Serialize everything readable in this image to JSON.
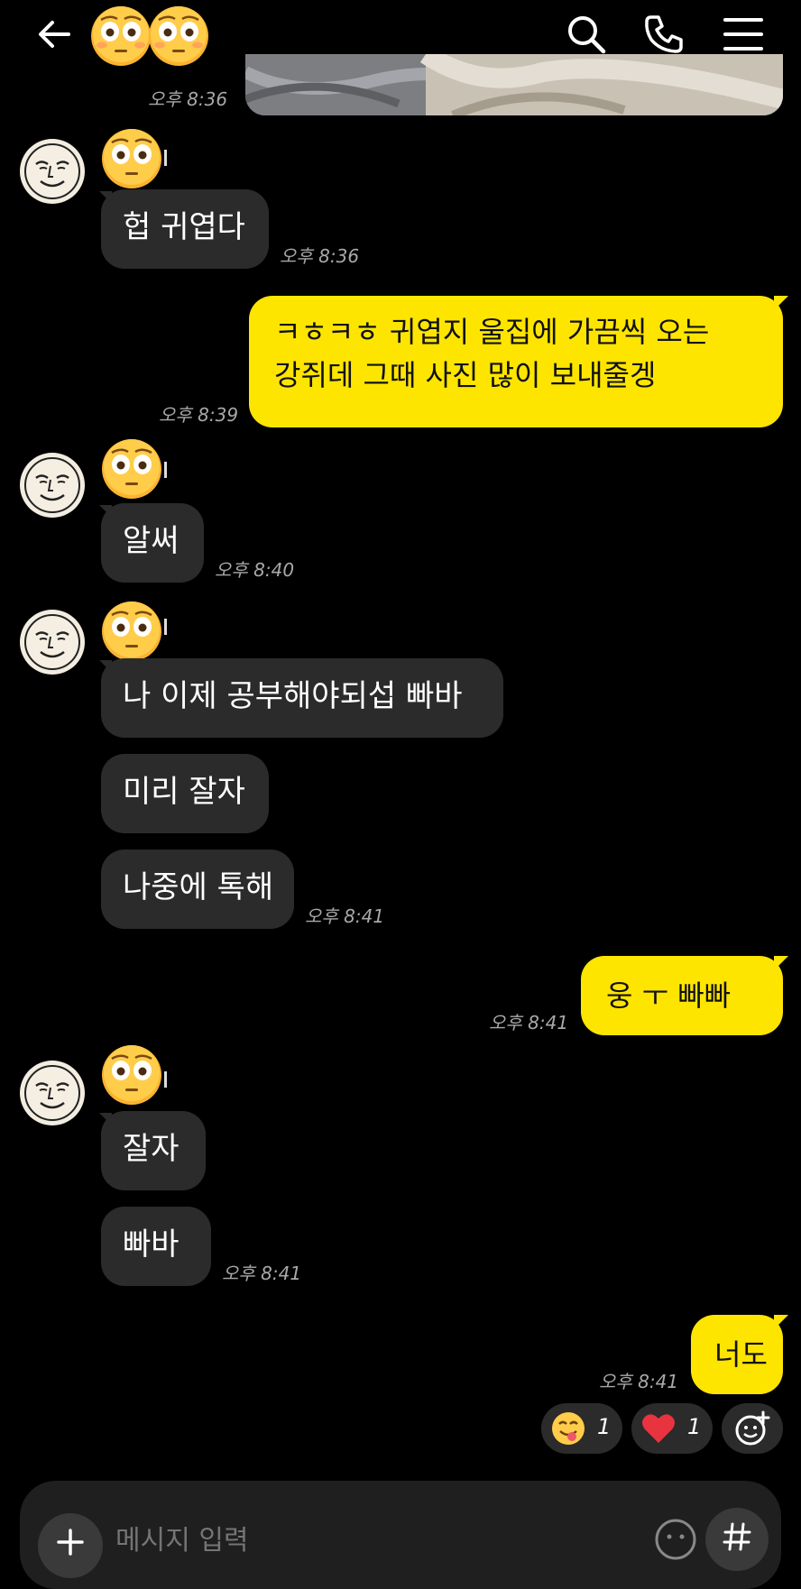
{
  "header": {
    "back_icon": "back-arrow-icon",
    "title_emojis": [
      "flushed-face-emoji",
      "flushed-face-emoji"
    ],
    "actions": [
      "search-icon",
      "phone-icon",
      "menu-icon"
    ]
  },
  "colors": {
    "background": "#000000",
    "incoming_bubble": "#2b2b2b",
    "outgoing_bubble": "#fee500",
    "timestamp": "#a8a8a8"
  },
  "messages": [
    {
      "id": "m0",
      "side": "out",
      "type": "image",
      "time": "오후 8:36"
    },
    {
      "id": "m1",
      "side": "in",
      "text": "헙 귀엽다",
      "time": "오후 8:36"
    },
    {
      "id": "m2",
      "side": "out",
      "line1": "ㅋㅎㅋㅎ 귀엽지 울집에 가끔씩 오는",
      "line2": "강쥐데 그때 사진 많이 보내줄겡",
      "time": "오후 8:39"
    },
    {
      "id": "m3",
      "side": "in",
      "text": "알써",
      "time": "오후 8:40"
    },
    {
      "id": "m4",
      "side": "in",
      "text": "나 이제 공부해야되섭 빠바"
    },
    {
      "id": "m5",
      "side": "in",
      "text": "미리 잘자"
    },
    {
      "id": "m6",
      "side": "in",
      "text": "나중에 톡해",
      "time": "오후 8:41"
    },
    {
      "id": "m7",
      "side": "out",
      "text": "웅 ㅜ 빠빠",
      "time": "오후 8:41"
    },
    {
      "id": "m8",
      "side": "in",
      "text": "잘자"
    },
    {
      "id": "m9",
      "side": "in",
      "text": "빠바",
      "time": "오후 8:41"
    },
    {
      "id": "m10",
      "side": "out",
      "text": "너도",
      "time": "오후 8:41"
    }
  ],
  "reactions": [
    {
      "icon": "yum-face-emoji",
      "count": "1"
    },
    {
      "icon": "heart-emoji",
      "count": "1"
    },
    {
      "icon": "add-reaction-icon"
    }
  ],
  "composer": {
    "placeholder": "메시지 입력",
    "add_icon": "plus-icon",
    "emoji_icon": "emoji-icon",
    "hash_icon": "hash-icon"
  }
}
